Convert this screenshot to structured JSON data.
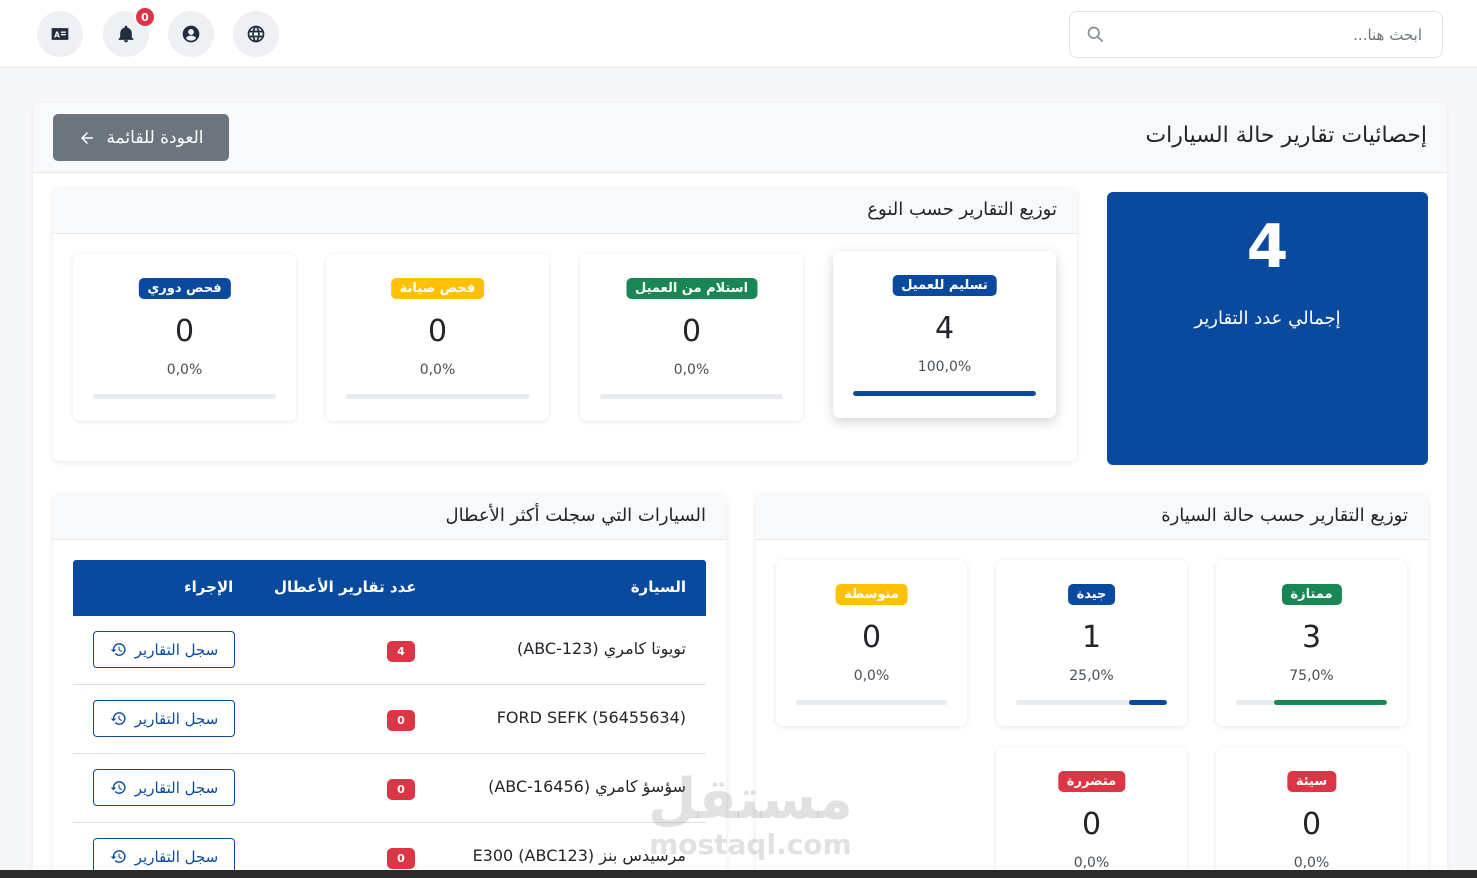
{
  "topbar": {
    "search_placeholder": "ابحث هنا...",
    "notifications_count": "0",
    "icons": [
      "translate-icon",
      "bell-icon",
      "user-circle-icon",
      "globe-icon",
      "search-icon"
    ]
  },
  "page": {
    "title": "إحصائيات تقارير حالة السيارات",
    "back_label": "العودة للقائمة"
  },
  "total": {
    "value": "4",
    "label": "إجمالي عدد التقارير"
  },
  "by_type": {
    "title": "توزيع التقارير حسب النوع",
    "items": [
      {
        "label": "تسليم للعميل",
        "value": "4",
        "percent": "100,0%",
        "fraction": 1.0,
        "color": "#0a4a9e"
      },
      {
        "label": "استلام من العميل",
        "value": "0",
        "percent": "0,0%",
        "fraction": 0,
        "color": "#198754"
      },
      {
        "label": "فحص صيانة",
        "value": "0",
        "percent": "0,0%",
        "fraction": 0,
        "color": "#ffc107"
      },
      {
        "label": "فحص دوري",
        "value": "0",
        "percent": "0,0%",
        "fraction": 0,
        "color": "#0a4a9e"
      }
    ]
  },
  "by_condition": {
    "title": "توزيع التقارير حسب حالة السيارة",
    "items": [
      {
        "label": "ممتازة",
        "value": "3",
        "percent": "75,0%",
        "fraction": 0.75,
        "color": "#198754"
      },
      {
        "label": "جيدة",
        "value": "1",
        "percent": "25,0%",
        "fraction": 0.25,
        "color": "#0a4a9e"
      },
      {
        "label": "متوسطة",
        "value": "0",
        "percent": "0,0%",
        "fraction": 0,
        "color": "#ffc107"
      },
      {
        "label": "سيئة",
        "value": "0",
        "percent": "0,0%",
        "fraction": 0,
        "color": "#dc3545"
      },
      {
        "label": "متضررة",
        "value": "0",
        "percent": "0,0%",
        "fraction": 0,
        "color": "#dc3545"
      }
    ]
  },
  "top_faults": {
    "title": "السيارات التي سجلت أكثر الأعطال",
    "columns": {
      "car": "السيارة",
      "count": "عدد تقارير الأعطال",
      "action": "الإجراء"
    },
    "action_label": "سجل التقارير",
    "rows": [
      {
        "car": "تويوتا كامري (ABC-123)",
        "count": "4"
      },
      {
        "car": "FORD SEFK (56455634)",
        "count": "0"
      },
      {
        "car": "سؤسؤ كامري (ABC-16456)",
        "count": "0"
      },
      {
        "car": "مرسيدس بنز (ABC123) E300",
        "count": "0"
      }
    ]
  },
  "watermark": {
    "ar": "مستقل",
    "en": "mostaql.com"
  }
}
